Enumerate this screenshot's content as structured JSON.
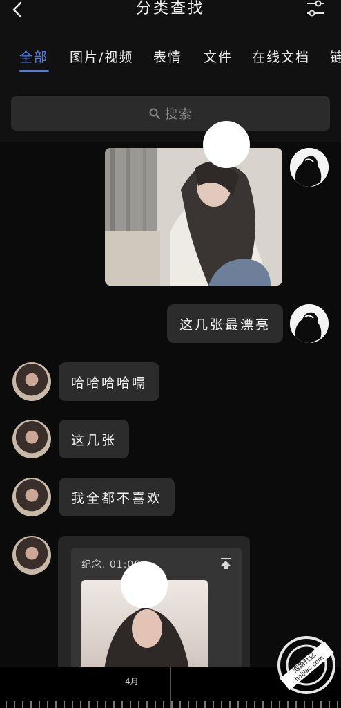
{
  "header": {
    "title": "分类查找",
    "back_icon": "chevron-left-icon",
    "filter_icon": "sliders-icon"
  },
  "tabs": [
    {
      "label": "全部",
      "active": true
    },
    {
      "label": "图片/视频",
      "active": false
    },
    {
      "label": "表情",
      "active": false
    },
    {
      "label": "文件",
      "active": false
    },
    {
      "label": "在线文档",
      "active": false
    },
    {
      "label": "链",
      "active": false
    }
  ],
  "search": {
    "placeholder": "搜索"
  },
  "messages": [
    {
      "from": "me",
      "type": "image"
    },
    {
      "from": "me",
      "type": "text",
      "text": "这几张最漂亮"
    },
    {
      "from": "other",
      "type": "text",
      "text": "哈哈哈哈嗝"
    },
    {
      "from": "other",
      "type": "text",
      "text": "这几张"
    },
    {
      "from": "other",
      "type": "text",
      "text": "我全都不喜欢"
    },
    {
      "from": "other",
      "type": "card",
      "label": "纪念. 01:00"
    }
  ],
  "timeline": {
    "month": "4月"
  },
  "watermark": {
    "text": "海角社区",
    "url": "haijiao.com"
  },
  "colors": {
    "accent": "#4d7df6",
    "bubble": "#2c2c2c",
    "background": "#111111"
  }
}
